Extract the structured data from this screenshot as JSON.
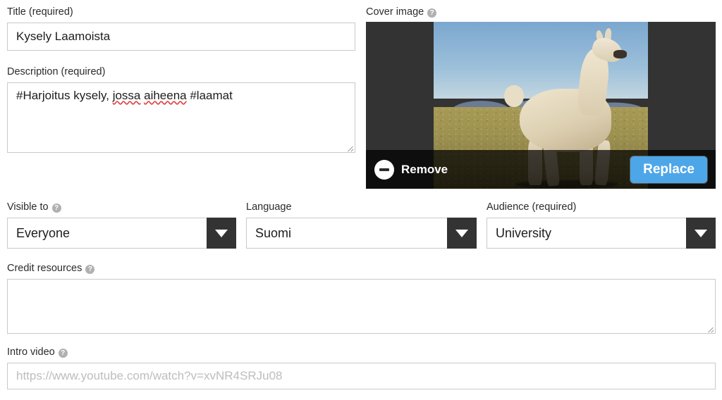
{
  "title_field": {
    "label": "Title (required)",
    "value": "Kysely Laamoista"
  },
  "description_field": {
    "label": "Description (required)",
    "value": "#Harjoitus kysely, jossa aiheena #laamat",
    "segments": {
      "a": "#Harjoitus kysely, ",
      "b": "jossa",
      "c": " ",
      "d": "aiheena",
      "e": " #laamat"
    }
  },
  "cover_image": {
    "label": "Cover image",
    "help": "?",
    "remove_label": "Remove",
    "replace_label": "Replace",
    "photo_alt": "llama standing in a field",
    "accent_blue": "#4da6e8",
    "letterbox_color": "#333333"
  },
  "visible_to": {
    "label": "Visible to",
    "help": "?",
    "value": "Everyone"
  },
  "language": {
    "label": "Language",
    "value": "Suomi"
  },
  "audience": {
    "label": "Audience (required)",
    "help": "?",
    "value": "University"
  },
  "credit_resources": {
    "label": "Credit resources",
    "help": "?",
    "value": "",
    "placeholder": ""
  },
  "intro_video": {
    "label": "Intro video",
    "help": "?",
    "value": "",
    "placeholder": "https://www.youtube.com/watch?v=xvNR4SRJu08"
  }
}
